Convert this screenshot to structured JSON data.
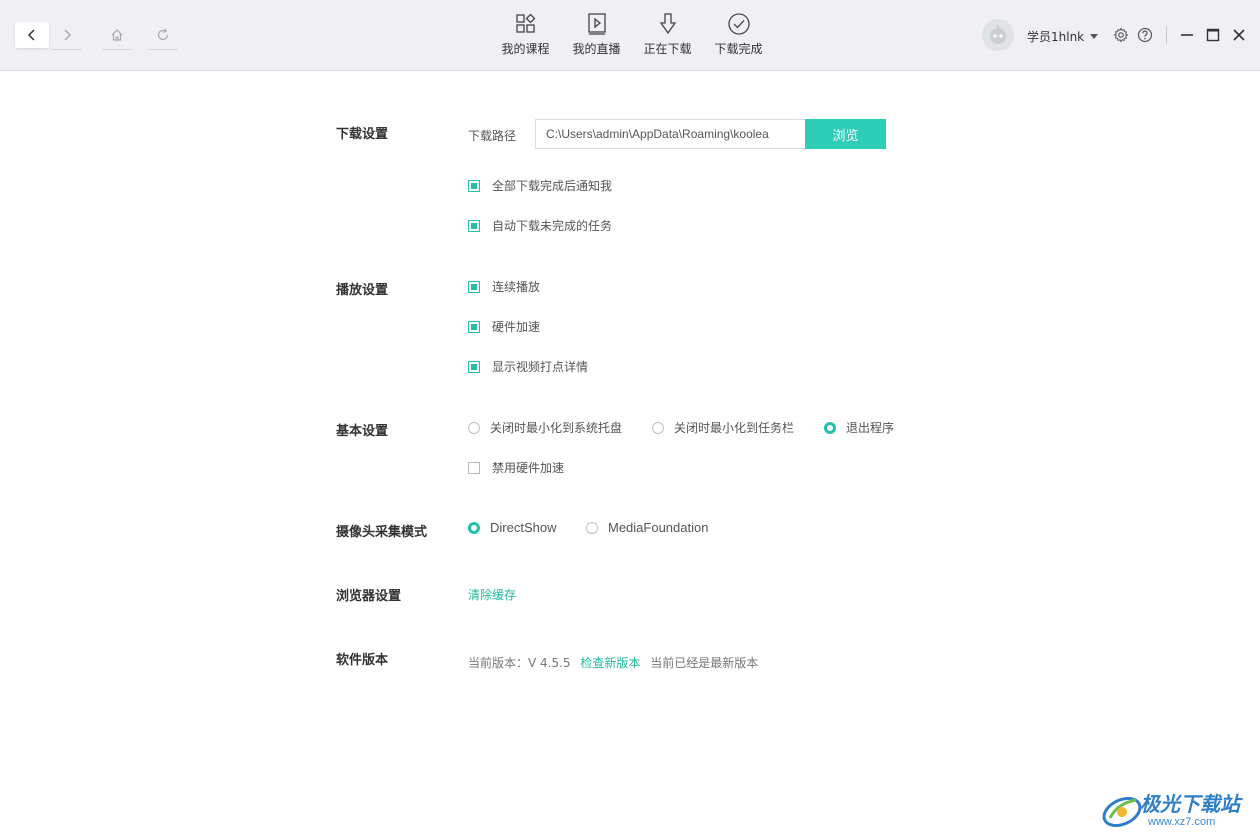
{
  "nav": {
    "back_icon": "chevron-left-icon",
    "forward_icon": "chevron-right-icon",
    "home_icon": "home-icon",
    "refresh_icon": "refresh-icon"
  },
  "tabs": [
    {
      "label": "我的课程",
      "icon": "grid-apps-icon"
    },
    {
      "label": "我的直播",
      "icon": "play-box-icon"
    },
    {
      "label": "正在下载",
      "icon": "download-arrow-icon"
    },
    {
      "label": "下载完成",
      "icon": "check-circle-icon"
    }
  ],
  "user": {
    "name": "学员1hlnk",
    "avatar_icon": "robot-avatar-icon"
  },
  "window": {
    "settings_icon": "gear-icon",
    "help_icon": "help-icon",
    "minimize_icon": "minimize-icon",
    "maximize_icon": "maximize-icon",
    "close_icon": "close-icon"
  },
  "download": {
    "title": "下载设置",
    "path_label": "下载路径",
    "path_value": "C:\\Users\\admin\\AppData\\Roaming\\koolea",
    "browse_label": "浏览",
    "opts": [
      "全部下载完成后通知我",
      "自动下载未完成的任务"
    ]
  },
  "playback": {
    "title": "播放设置",
    "opts": [
      "连续播放",
      "硬件加速",
      "显示视频打点详情"
    ]
  },
  "basic": {
    "title": "基本设置",
    "close_opts": [
      "关闭时最小化到系统托盘",
      "关闭时最小化到任务栏",
      "退出程序"
    ],
    "disable_hw": "禁用硬件加速"
  },
  "camera": {
    "title": "摄像头采集模式",
    "opts": [
      "DirectShow",
      "MediaFoundation"
    ]
  },
  "browser": {
    "title": "浏览器设置",
    "clear_cache": "清除缓存"
  },
  "version": {
    "title": "软件版本",
    "current": "当前版本：V 4.5.5",
    "check": "检查新版本",
    "status": "当前已经是最新版本"
  },
  "watermark": {
    "title": "极光下载站",
    "url": "www.xz7.com"
  },
  "colors": {
    "accent": "#2dcdb7",
    "link": "#1fb99f",
    "topbar": "#f0f0f4"
  }
}
